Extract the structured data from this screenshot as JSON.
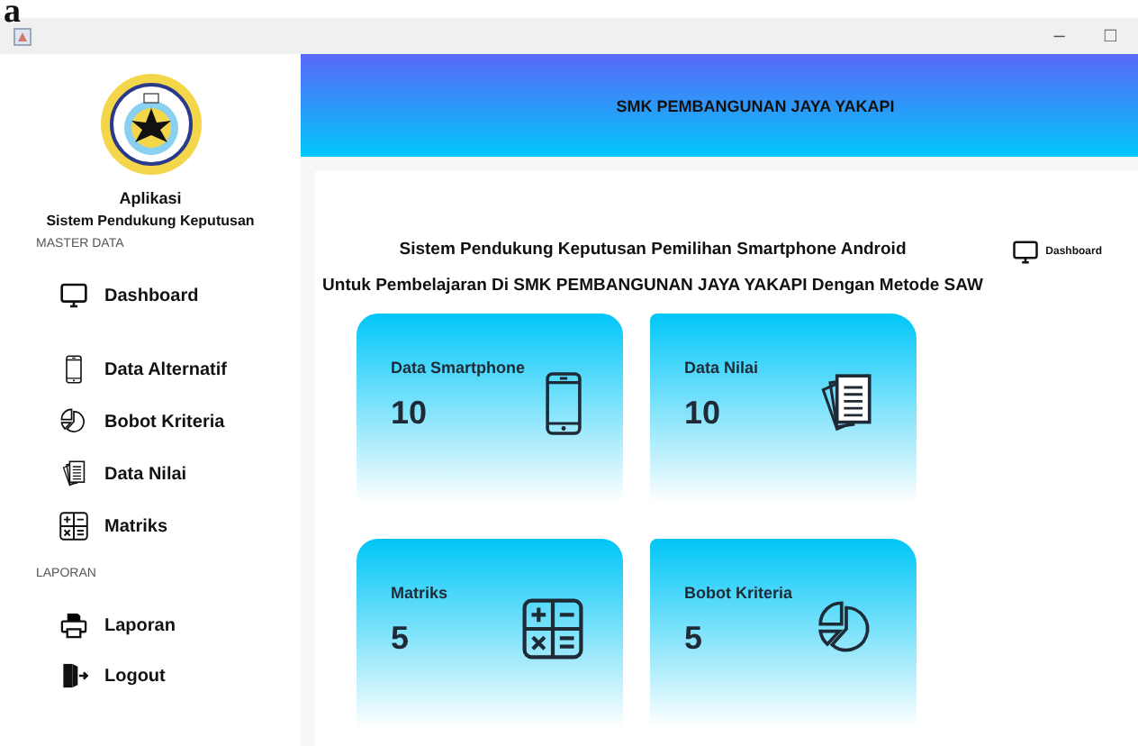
{
  "figure_label": "a",
  "window": {
    "controls": [
      "–",
      "□"
    ]
  },
  "sidebar": {
    "app_title": "Aplikasi",
    "app_subtitle": "Sistem Pendukung Keputusan",
    "sections": [
      {
        "heading": "MASTER DATA",
        "items": [
          {
            "label": "Dashboard"
          },
          {
            "label": "Data Alternatif"
          },
          {
            "label": "Bobot Kriteria"
          },
          {
            "label": "Data Nilai"
          },
          {
            "label": "Matriks"
          }
        ]
      },
      {
        "heading": "LAPORAN",
        "items": [
          {
            "label": "Laporan"
          },
          {
            "label": "Logout"
          }
        ]
      }
    ]
  },
  "header": {
    "title": "SMK PEMBANGUNAN JAYA YAKAPI"
  },
  "breadcrumb": "Dashboard",
  "titles": [
    "Sistem Pendukung Keputusan Pemilihan Smartphone Android",
    "Untuk Pembelajaran Di SMK PEMBANGUNAN JAYA YAKAPI Dengan Metode SAW"
  ],
  "cards": [
    {
      "label": "Data Smartphone",
      "value": "10"
    },
    {
      "label": "Data Nilai",
      "value": "10"
    },
    {
      "label": "Matriks",
      "value": "5"
    },
    {
      "label": "Bobot Kriteria",
      "value": "5"
    }
  ]
}
